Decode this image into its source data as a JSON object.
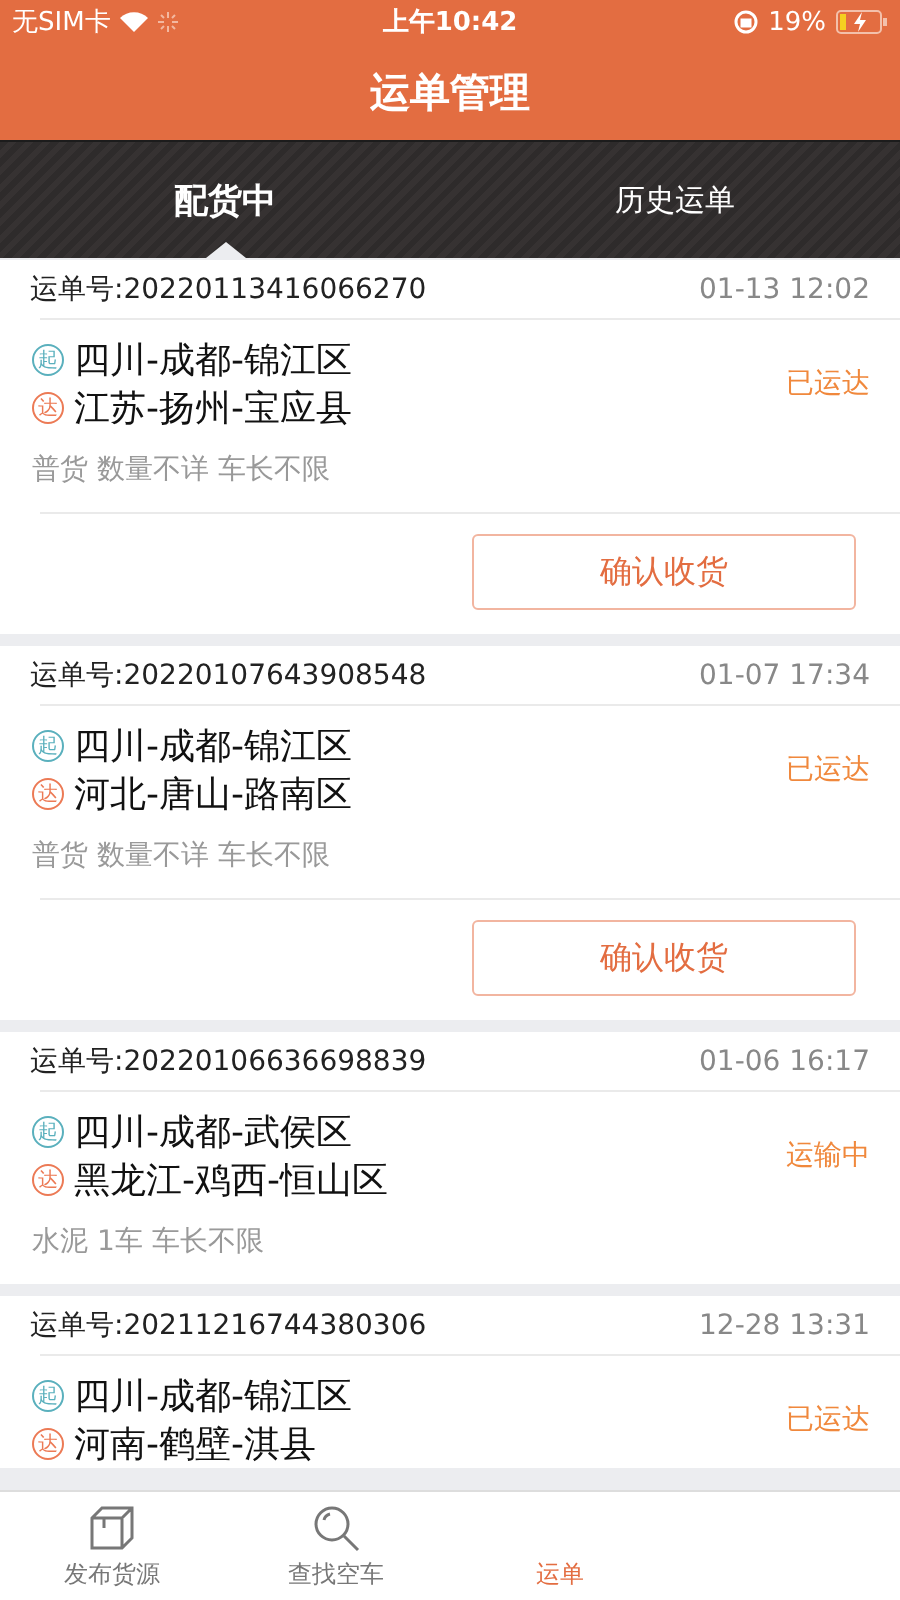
{
  "status_bar": {
    "carrier": "无SIM卡",
    "time": "上午10:42",
    "battery": "19%"
  },
  "title": "运单管理",
  "tabs": [
    {
      "label": "配货中",
      "selected": true
    },
    {
      "label": "历史运单",
      "selected": false
    }
  ],
  "orders": [
    {
      "number": "运单号:20220113416066270",
      "time": "01-13 12:02",
      "from_badge": "起",
      "from": "四川-成都-锦江区",
      "to_badge": "达",
      "to": "江苏-扬州-宝应县",
      "status": "已运达",
      "goods": "普货 数量不详 车长不限",
      "action": "确认收货"
    },
    {
      "number": "运单号:20220107643908548",
      "time": "01-07 17:34",
      "from_badge": "起",
      "from": "四川-成都-锦江区",
      "to_badge": "达",
      "to": "河北-唐山-路南区",
      "status": "已运达",
      "goods": "普货 数量不详 车长不限",
      "action": "确认收货"
    },
    {
      "number": "运单号:20220106636698839",
      "time": "01-06 16:17",
      "from_badge": "起",
      "from": "四川-成都-武侯区",
      "to_badge": "达",
      "to": "黑龙江-鸡西-恒山区",
      "status": "运输中",
      "goods": "水泥 1车 车长不限"
    },
    {
      "number": "运单号:20211216744380306",
      "time": "12-28 13:31",
      "from_badge": "起",
      "from": "四川-成都-锦江区",
      "to_badge": "达",
      "to": "河南-鹤壁-淇县",
      "status": "已运达"
    }
  ],
  "bottom_nav": [
    {
      "label": "发布货源",
      "kind": "box",
      "selected": false
    },
    {
      "label": "查找空车",
      "kind": "search",
      "selected": false
    },
    {
      "label": "运单",
      "kind": "hidden",
      "selected": true
    }
  ]
}
